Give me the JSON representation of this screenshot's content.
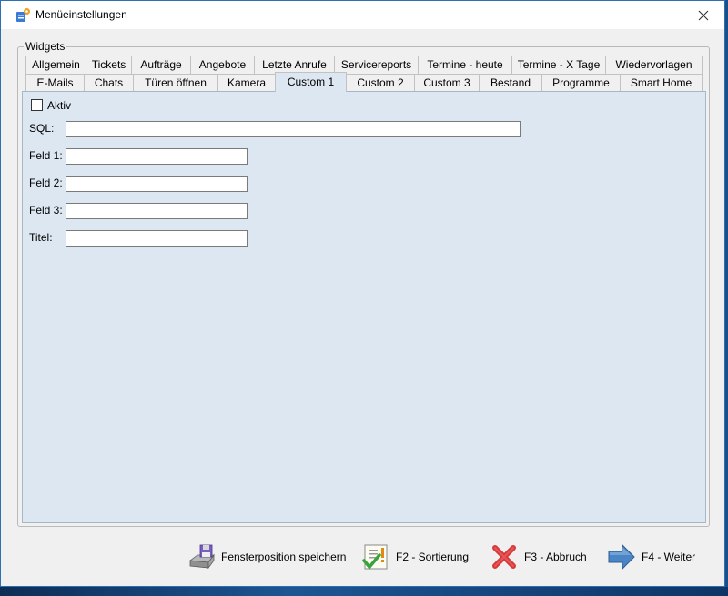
{
  "window": {
    "title": "Menüeinstellungen"
  },
  "group": {
    "label": "Widgets"
  },
  "tabs_row1": [
    {
      "label": "Allgemein",
      "w": 67
    },
    {
      "label": "Tickets",
      "w": 51
    },
    {
      "label": "Aufträge",
      "w": 66
    },
    {
      "label": "Angebote",
      "w": 71
    },
    {
      "label": "Letzte Anrufe",
      "w": 89
    },
    {
      "label": "Servicereports",
      "w": 93
    },
    {
      "label": "Termine - heute",
      "w": 104
    },
    {
      "label": "Termine - X Tage",
      "w": 104
    },
    {
      "label": "Wiedervorlagen",
      "w": 107
    }
  ],
  "tabs_row2": [
    {
      "label": "E-Mails",
      "w": 65
    },
    {
      "label": "Chats",
      "w": 55
    },
    {
      "label": "Türen öffnen",
      "w": 94
    },
    {
      "label": "Kamera",
      "w": 64
    },
    {
      "label": "Custom 1",
      "w": 79,
      "active": true
    },
    {
      "label": "Custom 2",
      "w": 76
    },
    {
      "label": "Custom 3",
      "w": 72
    },
    {
      "label": "Bestand",
      "w": 70
    },
    {
      "label": "Programme",
      "w": 87
    },
    {
      "label": "Smart Home",
      "w": 91
    }
  ],
  "form": {
    "aktiv_label": "Aktiv",
    "aktiv_checked": false,
    "sql_label": "SQL:",
    "sql_value": "",
    "feld1_label": "Feld 1:",
    "feld1_value": "",
    "feld2_label": "Feld 2:",
    "feld2_value": "",
    "feld3_label": "Feld 3:",
    "feld3_value": "",
    "titel_label": "Titel:",
    "titel_value": ""
  },
  "footer": {
    "save_label": "Fensterposition speichern",
    "sort_label": "F2 - Sortierung",
    "cancel_label": "F3 - Abbruch",
    "next_label": "F4 - Weiter"
  },
  "icons": {
    "app": "settings-app-icon",
    "close": "close-icon",
    "save": "floppy-drive-icon",
    "sort": "checklist-icon",
    "cancel": "red-x-icon",
    "next": "blue-arrow-right-icon"
  },
  "colors": {
    "panel": "#dde7f1",
    "titlebar": "#ffffff",
    "window": "#f0f0f0",
    "cancel": "#d9383a",
    "next": "#4a86c5"
  }
}
